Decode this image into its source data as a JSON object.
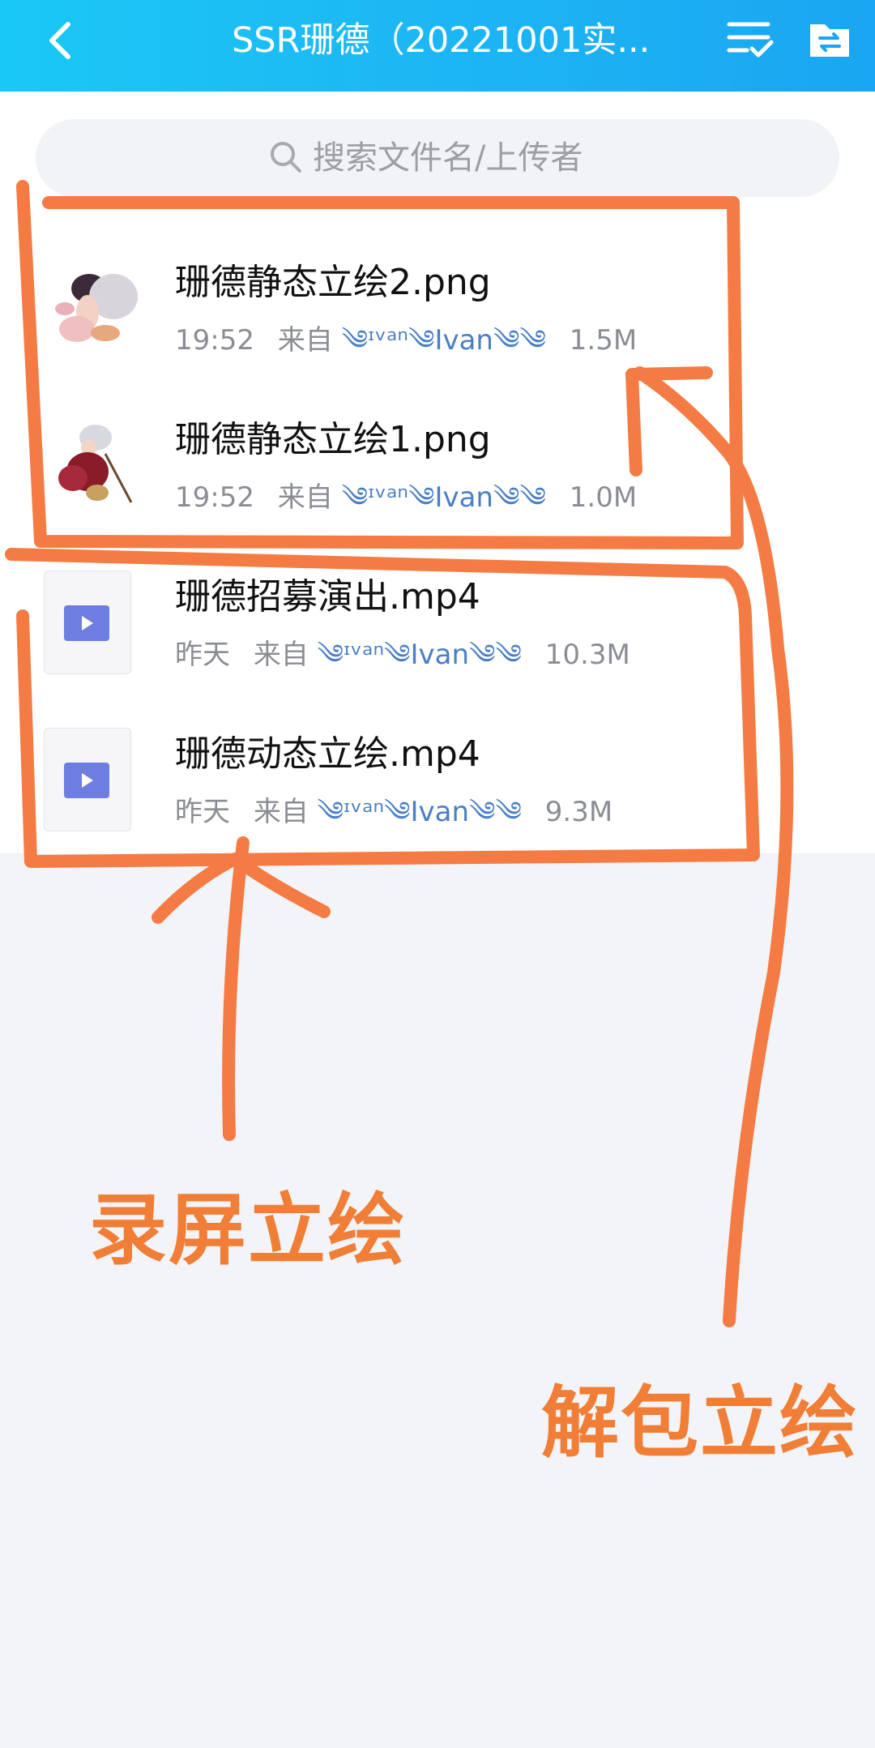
{
  "header": {
    "title": "SSR珊德（20221001实...",
    "back_icon": "chevron-left-icon",
    "multiselect_icon": "list-check-icon",
    "folder_icon": "folder-swap-icon"
  },
  "search": {
    "placeholder": "搜索文件名/上传者",
    "icon": "search-icon"
  },
  "files": [
    {
      "name": "珊德静态立绘2.png",
      "time": "19:52",
      "from": "来自",
      "uploader": "༄ᶦᵛᵃⁿ༄Ivan༄༄",
      "size": "1.5M",
      "type": "image"
    },
    {
      "name": "珊德静态立绘1.png",
      "time": "19:52",
      "from": "来自",
      "uploader": "༄ᶦᵛᵃⁿ༄Ivan༄༄",
      "size": "1.0M",
      "type": "image"
    },
    {
      "name": "珊德招募演出.mp4",
      "time": "昨天",
      "from": "来自",
      "uploader": "༄ᶦᵛᵃⁿ༄Ivan༄༄",
      "size": "10.3M",
      "type": "video"
    },
    {
      "name": "珊德动态立绘.mp4",
      "time": "昨天",
      "from": "来自",
      "uploader": "༄ᶦᵛᵃⁿ༄Ivan༄༄",
      "size": "9.3M",
      "type": "video"
    }
  ],
  "annotations": {
    "left_label": "录屏立绘",
    "right_label": "解包立绘",
    "color": "#f07e36"
  },
  "colors": {
    "header_gradient_start": "#1ac8f5",
    "header_gradient_end": "#1aa6f2",
    "uploader": "#4a7fc4",
    "video_play": "#6e7ee0"
  }
}
